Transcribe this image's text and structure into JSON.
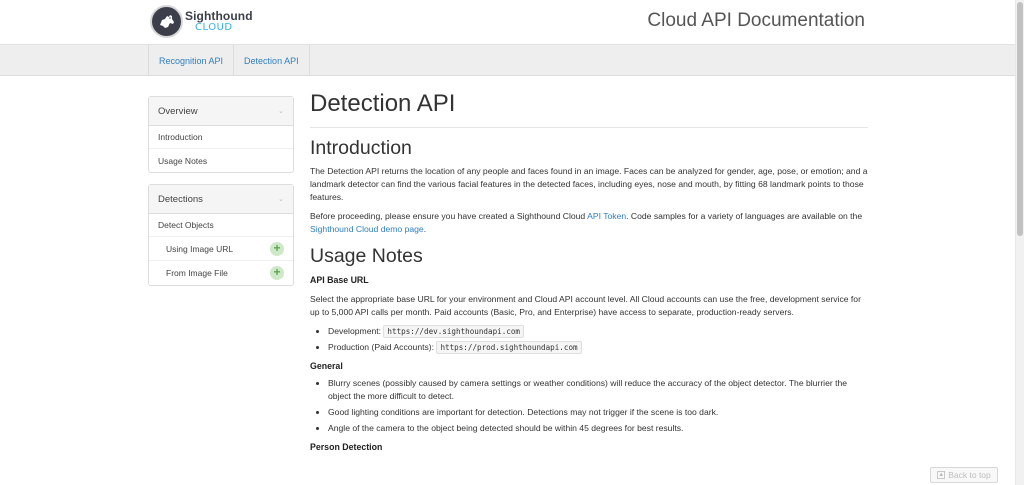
{
  "header": {
    "logo_name": "Sighthound",
    "logo_sub": "CLOUD",
    "site_title": "Cloud API Documentation"
  },
  "topnav": {
    "tabs": [
      {
        "label": "Recognition API"
      },
      {
        "label": "Detection API"
      }
    ]
  },
  "sidebar": {
    "overview": {
      "heading": "Overview",
      "items": [
        {
          "label": "Introduction"
        },
        {
          "label": "Usage Notes"
        }
      ]
    },
    "detections": {
      "heading": "Detections",
      "items": [
        {
          "label": "Detect Objects"
        },
        {
          "label": "Using Image URL"
        },
        {
          "label": "From Image File"
        }
      ]
    }
  },
  "main": {
    "title": "Detection API",
    "intro": {
      "heading": "Introduction",
      "p1": "The Detection API returns the location of any people and faces found in an image. Faces can be analyzed for gender, age, pose, or emotion; and a landmark detector can find the various facial features in the detected faces, including eyes, nose and mouth, by fitting 68 landmark points to those features.",
      "p2_a": "Before proceeding, please ensure you have created a Sighthound Cloud ",
      "p2_link1": "API Token",
      "p2_b": ". Code samples for a variety of languages are available on the ",
      "p2_link2": "Sighthound Cloud demo page",
      "p2_c": "."
    },
    "usage": {
      "heading": "Usage Notes",
      "api_base": {
        "heading": "API Base URL",
        "text": "Select the appropriate base URL for your environment and Cloud API account level. All Cloud accounts can use the free, development service for up to 5,000 API calls per month. Paid accounts (Basic, Pro, and Enterprise) have access to separate, production-ready servers.",
        "urls": [
          {
            "label": "Development:",
            "url": "https://dev.sighthoundapi.com"
          },
          {
            "label": "Production (Paid Accounts):",
            "url": "https://prod.sighthoundapi.com"
          }
        ]
      },
      "general": {
        "heading": "General",
        "items": [
          "Blurry scenes (possibly caused by camera settings or weather conditions) will reduce the accuracy of the object detector. The blurrier the object the more difficult to detect.",
          "Good lighting conditions are important for detection. Detections may not trigger if the scene is too dark.",
          "Angle of the camera to the object being detected should be within 45 degrees for best results."
        ]
      },
      "next_heading": "Person Detection"
    }
  },
  "back_to_top": "Back to top"
}
